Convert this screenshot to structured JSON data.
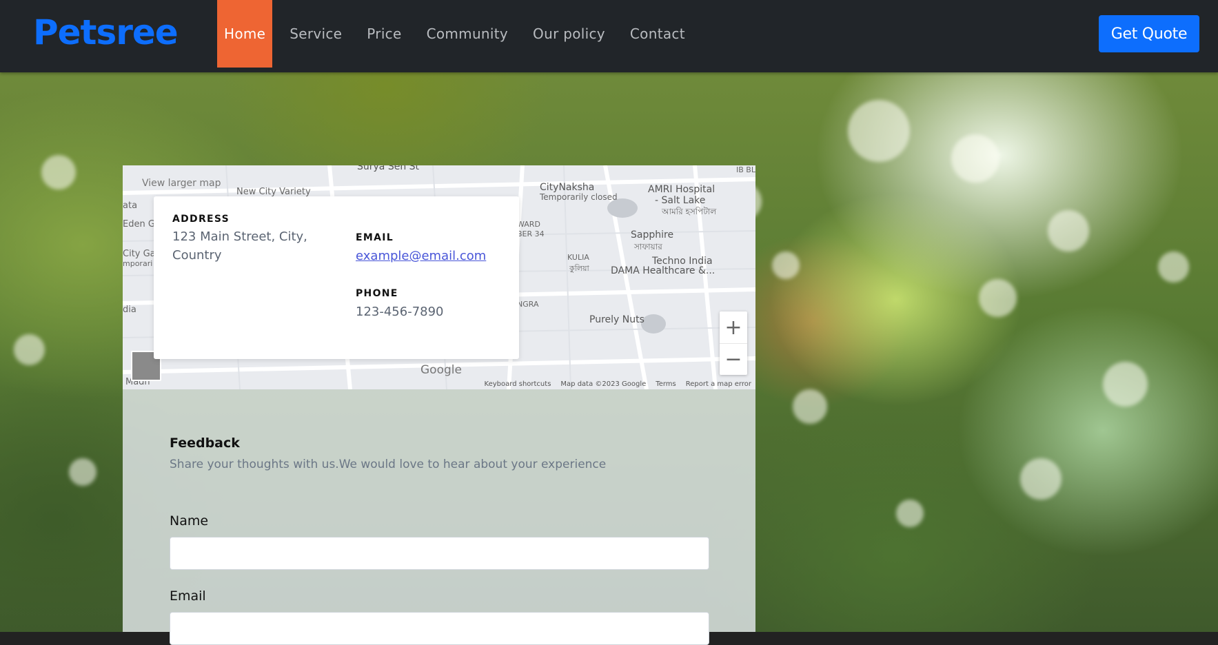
{
  "brand": "Petsree",
  "nav": {
    "items": [
      {
        "label": "Home",
        "active": true
      },
      {
        "label": "Service"
      },
      {
        "label": "Price"
      },
      {
        "label": "Community"
      },
      {
        "label": "Our policy"
      },
      {
        "label": "Contact"
      }
    ],
    "cta": "Get Quote"
  },
  "colors": {
    "brand": "#0d6efd",
    "active_nav": "#ee6533",
    "navbar_bg": "#212529",
    "cta_bg": "#0d6efd"
  },
  "map": {
    "larger_map_link": "View larger map",
    "labels": {
      "surya_sen": "Surya Sen St",
      "new_city": "New City Variety",
      "citynaksha": "CityNaksha",
      "citynaksha_status": "Temporarily closed",
      "amri": "AMRI Hospital",
      "amri2": "- Salt Lake",
      "amri_bn": "আমরি হসপিটাল",
      "sapphire": "Sapphire",
      "sapphire_bn": "সাফায়ার",
      "techno": "Techno India",
      "dama": "DAMA Healthcare &...",
      "kulia": "KULIA",
      "kulia_bn": "কুলিয়া",
      "purely": "Purely Nuts",
      "ward": "WARD",
      "ber34": "BER 34",
      "ngra": "NGRA",
      "eden": "Eden G",
      "city_ga": "City Ga",
      "mporari": "mporari",
      "ata": "ata",
      "dia": "dia",
      "madh": "Madh",
      "ibb": "IB BL"
    },
    "google_logo": "Google",
    "zoom_in": "+",
    "zoom_out": "−",
    "footer": [
      "Keyboard shortcuts",
      "Map data ©2023 Google",
      "Terms",
      "Report a map error"
    ]
  },
  "contact": {
    "address_label": "ADDRESS",
    "address_line1": "123 Main Street, City,",
    "address_line2": "Country",
    "email_label": "EMAIL",
    "email": "example@email.com",
    "phone_label": "PHONE",
    "phone": "123-456-7890"
  },
  "feedback": {
    "title": "Feedback",
    "subtitle": "Share your thoughts with us.We would love to hear about your experience",
    "name_label": "Name",
    "name_value": "",
    "email_label": "Email",
    "email_value": ""
  }
}
